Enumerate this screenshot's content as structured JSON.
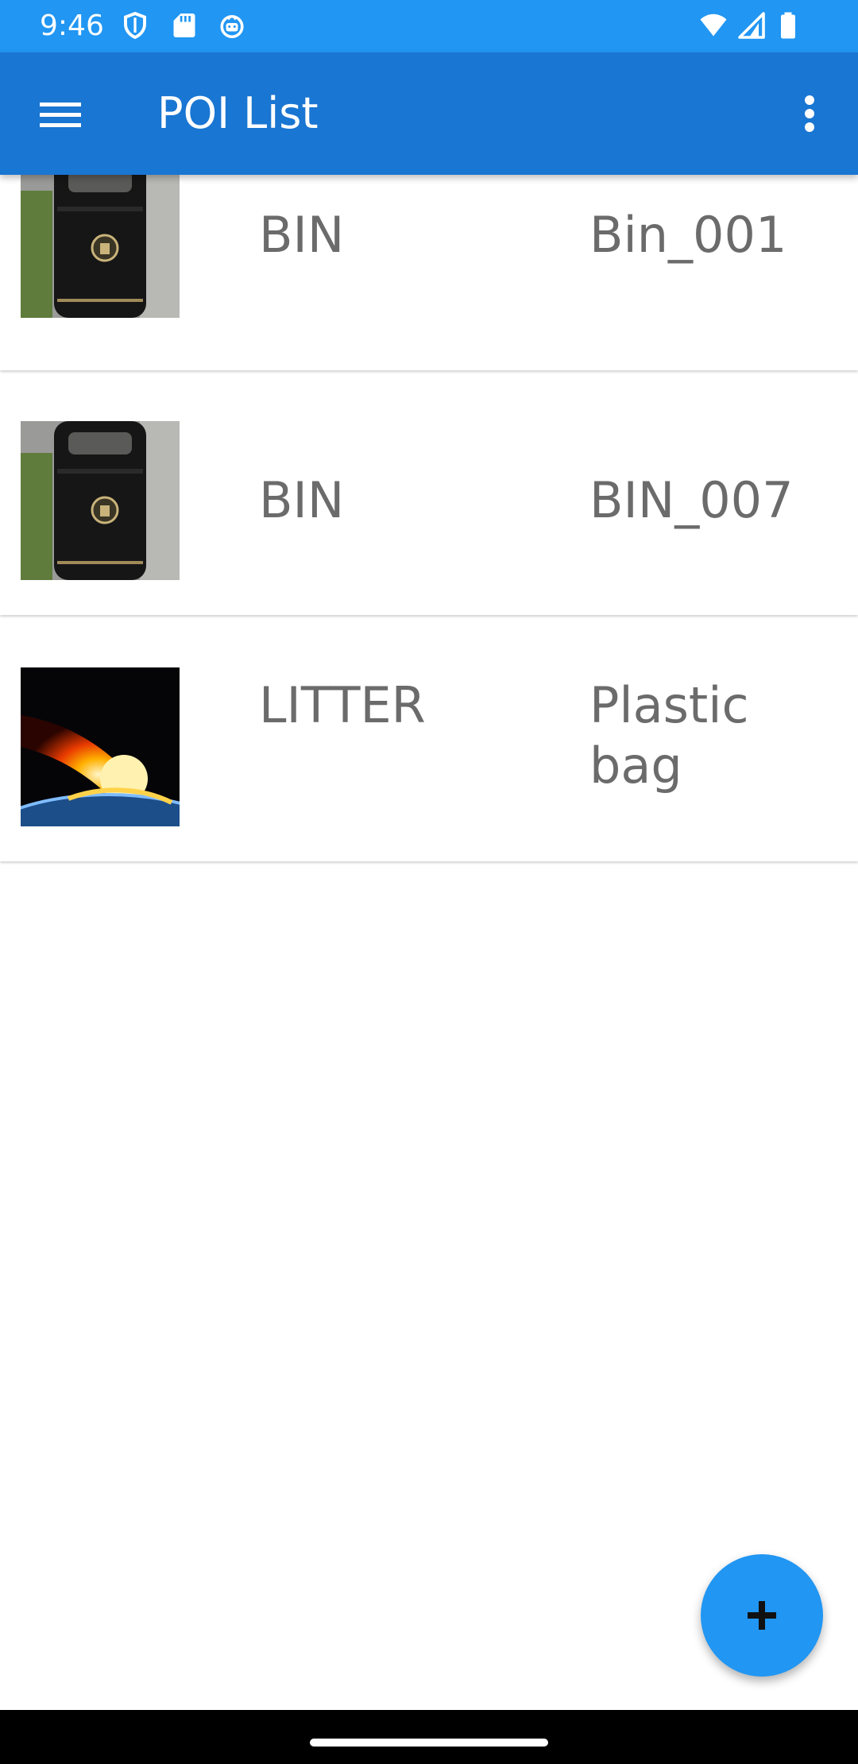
{
  "status_bar": {
    "time": "9:46",
    "left_icons": [
      "shield-icon",
      "sd-card-icon",
      "android-debug-icon"
    ],
    "right_icons": [
      "wifi-icon",
      "cell-signal-icon",
      "battery-icon"
    ]
  },
  "app_bar": {
    "title": "POI List",
    "menu_icon": "hamburger-menu-icon",
    "overflow_icon": "more-vert-icon"
  },
  "poi_list": [
    {
      "type": "BIN",
      "name": "Bin_001",
      "thumbnail": "litter-bin-photo"
    },
    {
      "type": "BIN",
      "name": "BIN_007",
      "thumbnail": "litter-bin-photo"
    },
    {
      "type": "LITTER",
      "name": "Plastic bag",
      "thumbnail": "meteor-earth-photo"
    }
  ],
  "fab": {
    "icon": "plus-icon"
  },
  "colors": {
    "status_bar": "#2196F3",
    "app_bar": "#1976D2",
    "accent": "#2196F3",
    "item_text": "#6b6b6b"
  }
}
